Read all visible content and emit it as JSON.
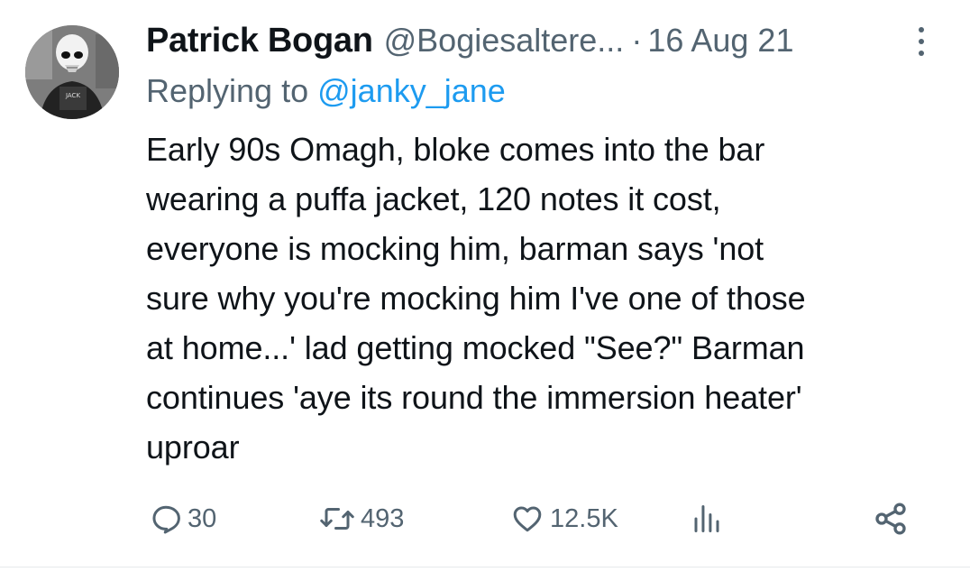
{
  "tweet": {
    "author_name": "Patrick Bogan",
    "author_handle": "@Bogiesaltere...",
    "separator": "·",
    "date": "16 Aug 21",
    "replying_prefix": "Replying to",
    "replying_handle": "@janky_jane",
    "text": "Early 90s Omagh, bloke comes into the bar\nwearing a puffa jacket, 120 notes it cost,\neveryone is mocking him, barman says 'not\nsure why you're mocking him I've one of those\nat home...' lad getting mocked \"See?\" Barman\ncontinues 'aye its round the immersion heater'\nuproar"
  },
  "actions": {
    "replies": "30",
    "retweets": "493",
    "likes": "12.5K"
  },
  "icons": {
    "avatar": "avatar-image",
    "more": "more-options-icon",
    "reply": "reply-icon",
    "retweet": "retweet-icon",
    "like": "heart-icon",
    "views": "analytics-icon",
    "share": "share-icon"
  },
  "colors": {
    "text": "#0f1419",
    "secondary": "#536471",
    "link": "#1d9bf0"
  }
}
